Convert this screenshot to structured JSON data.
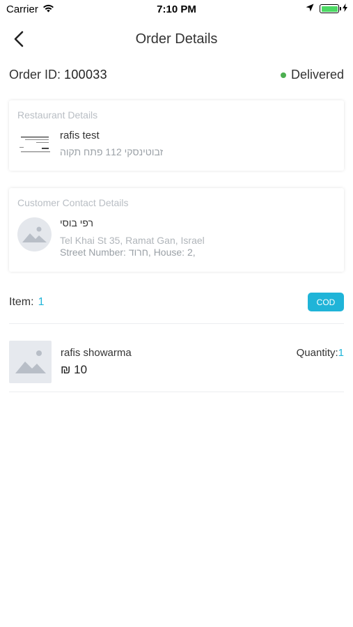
{
  "status_bar": {
    "carrier": "Carrier",
    "time": "7:10 PM"
  },
  "nav": {
    "title": "Order Details"
  },
  "order": {
    "id_label": "Order ID:",
    "id_value": "100033",
    "status": "Delivered",
    "status_color": "#4caf50"
  },
  "restaurant": {
    "section_title": "Restaurant Details",
    "name": "rafis test",
    "address": "זבוטינסקי 112 פתח תקוה"
  },
  "customer": {
    "section_title": "Customer Contact Details",
    "name": "רפי בוסי",
    "address": "Tel Khai St 35, Ramat Gan, Israel",
    "street": "Street Number: חרוד, House: 2,"
  },
  "items": {
    "label": "Item:",
    "count": "1",
    "payment_badge": "COD",
    "accent_color": "#1fb4d8",
    "list": [
      {
        "name": "rafis showarma",
        "price": "₪ 10",
        "quantity_label": "Quantity:",
        "quantity": "1"
      }
    ]
  }
}
